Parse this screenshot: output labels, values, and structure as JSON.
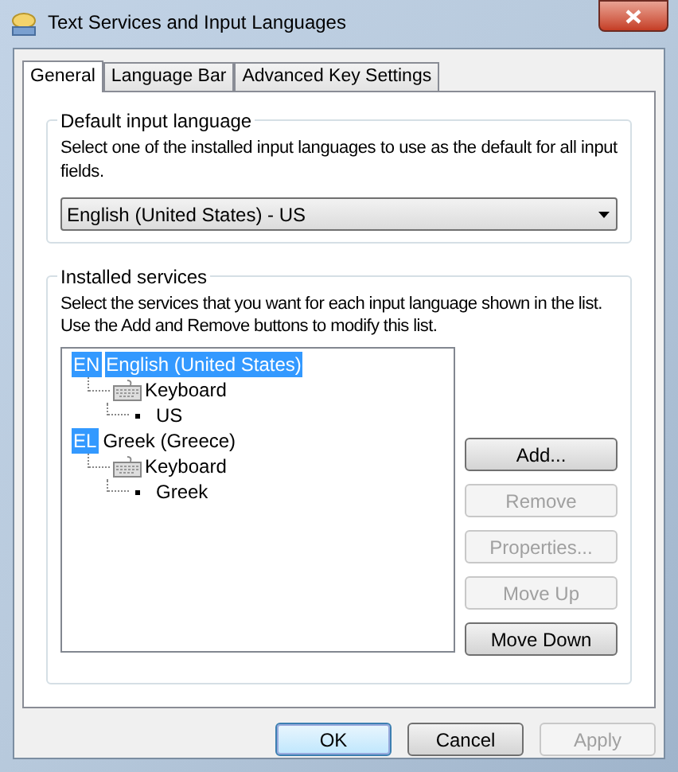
{
  "window": {
    "title": "Text Services and Input Languages"
  },
  "tabs": [
    {
      "label": "General",
      "selected": true
    },
    {
      "label": "Language Bar",
      "selected": false
    },
    {
      "label": "Advanced Key Settings",
      "selected": false
    }
  ],
  "default_input_language": {
    "title": "Default input language",
    "description": "Select one of the installed input languages to use as the default for all input fields.",
    "dropdown": {
      "value": "English (United States) - US"
    }
  },
  "installed_services": {
    "title": "Installed services",
    "description_lines": [
      "Select the services that you want for each input language shown in the list.",
      "Use the Add and Remove buttons to modify this list."
    ],
    "tree": [
      {
        "badge": "EN",
        "label": "English (United States)",
        "selected": true,
        "children": [
          {
            "label": "Keyboard",
            "children": [
              {
                "label": "US"
              }
            ]
          }
        ]
      },
      {
        "badge": "EL",
        "label": "Greek (Greece)",
        "selected": false,
        "children": [
          {
            "label": "Keyboard",
            "children": [
              {
                "label": "Greek"
              }
            ]
          }
        ]
      }
    ],
    "buttons": [
      {
        "label": "Add...",
        "disabled": false
      },
      {
        "label": "Remove",
        "disabled": true
      },
      {
        "label": "Properties...",
        "disabled": true
      },
      {
        "label": "Move Up",
        "disabled": true
      },
      {
        "label": "Move Down",
        "disabled": false
      }
    ]
  },
  "dialog_buttons": [
    {
      "label": "OK",
      "disabled": false,
      "default": true
    },
    {
      "label": "Cancel",
      "disabled": false,
      "default": false
    },
    {
      "label": "Apply",
      "disabled": true,
      "default": false
    }
  ]
}
